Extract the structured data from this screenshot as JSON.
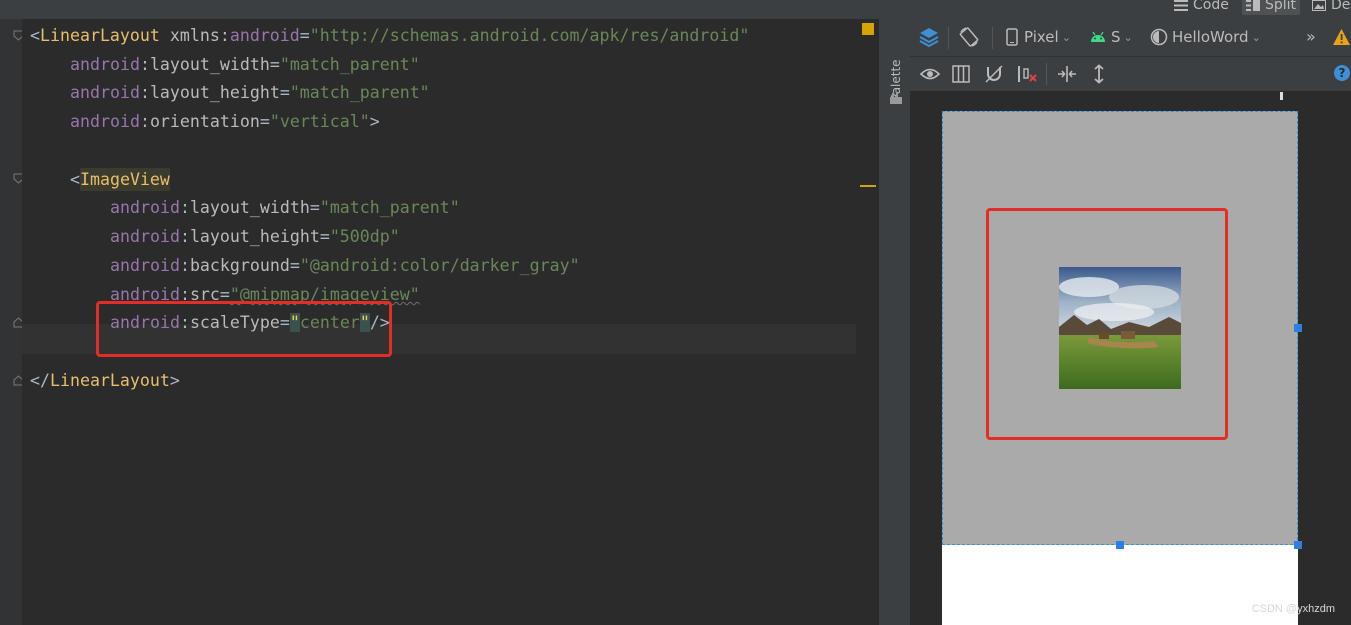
{
  "topbar": {
    "code_label": "Code",
    "split_label": "Split",
    "design_label": "De"
  },
  "editor": {
    "lines": {
      "l1_tag": "LinearLayout",
      "l1_ns_attr": "xmlns:",
      "l1_ns": "android",
      "l1_value": "\"http://schemas.android.com/apk/res/android\"",
      "l2_ns": "android",
      "l2_attr": "layout_width",
      "l2_value": "\"match_parent\"",
      "l3_ns": "android",
      "l3_attr": "layout_height",
      "l3_value": "\"match_parent\"",
      "l4_ns": "android",
      "l4_attr": "orientation",
      "l4_value": "\"vertical\"",
      "l6_tag": "ImageView",
      "l7_ns": "android",
      "l7_attr": "layout_width",
      "l7_value": "\"match_parent\"",
      "l8_ns": "android",
      "l8_attr": "layout_height",
      "l8_value": "\"500dp\"",
      "l9_ns": "android",
      "l9_attr": "background",
      "l9_value": "\"@android:color/darker_gray\"",
      "l10_ns": "android",
      "l10_attr": "src",
      "l10_value": "\"@mipmap/imageview\"",
      "l11_ns": "android",
      "l11_attr": "scaleType",
      "l11_value_text": "center",
      "l13_tag": "LinearLayout"
    }
  },
  "palette": {
    "label": "Palette"
  },
  "design": {
    "device_label": "Pixel",
    "api_label": "S",
    "theme_label": "HelloWord",
    "overflow_label": "»",
    "help_label": "?"
  },
  "watermark": "CSDN @yxhzdm",
  "colors": {
    "tag": "#e8bf6a",
    "namespace": "#9876aa",
    "string": "#6a8759",
    "annotation_red": "#e52d27",
    "selection_blue": "#2f7fe0",
    "image_background": "#aaaaaa"
  }
}
